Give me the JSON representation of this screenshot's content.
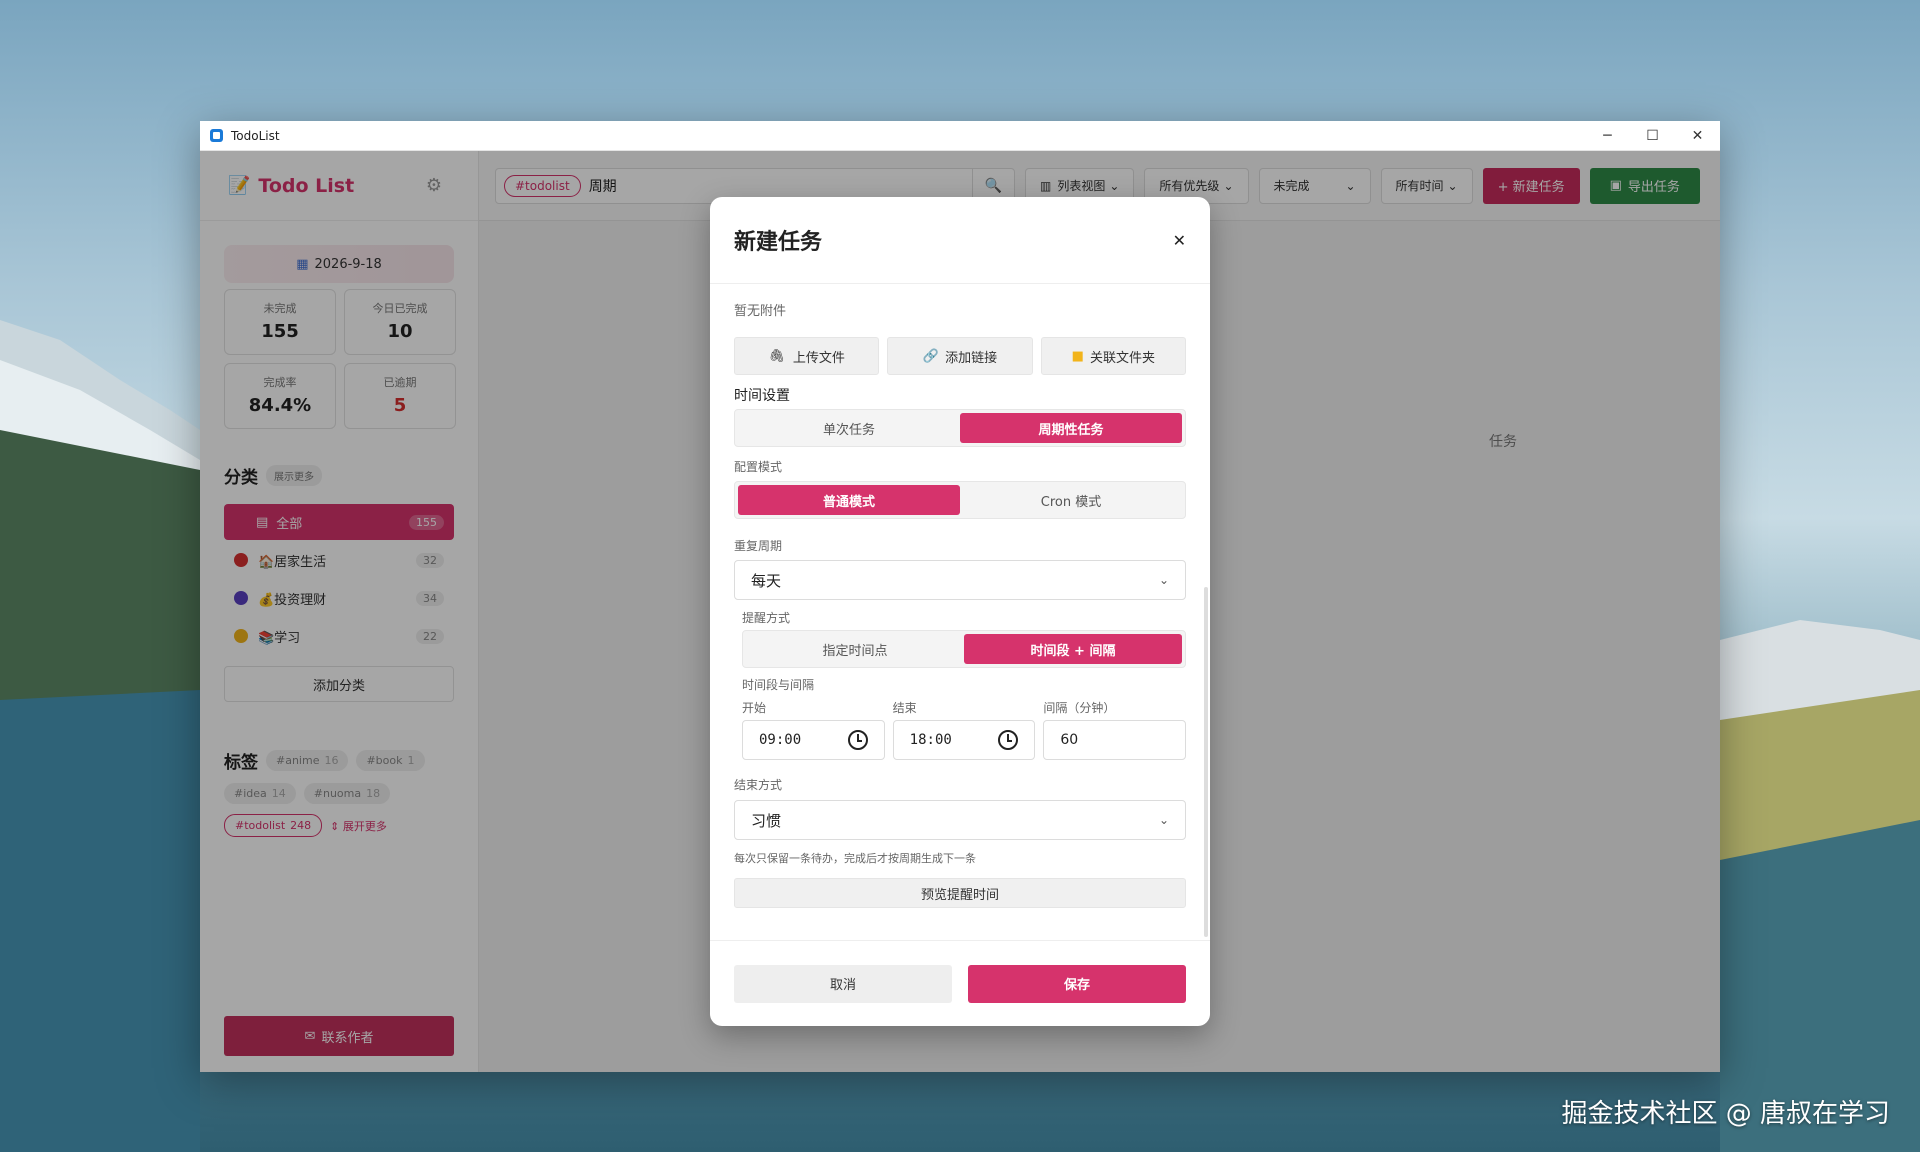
{
  "window": {
    "title": "TodoList",
    "minimize": "─",
    "maximize": "☐",
    "close": "✕"
  },
  "sidebar": {
    "logo": "Todo List",
    "date": "2026-9-18",
    "stats": [
      {
        "label": "未完成",
        "value": "155"
      },
      {
        "label": "今日已完成",
        "value": "10"
      },
      {
        "label": "完成率",
        "value": "84.4%"
      },
      {
        "label": "已逾期",
        "value": "5"
      }
    ],
    "categories_title": "分类",
    "show_more": "展示更多",
    "categories": [
      {
        "label": "全部",
        "count": "155",
        "color": "#d6336c"
      },
      {
        "label": "🏠居家生活",
        "count": "32",
        "color": "#d63030"
      },
      {
        "label": "💰投资理财",
        "count": "34",
        "color": "#5a3fc0"
      },
      {
        "label": "📚学习",
        "count": "22",
        "color": "#f2b41b"
      }
    ],
    "add_category": "添加分类",
    "tags_title": "标签",
    "tags": [
      {
        "name": "#anime",
        "count": "16"
      },
      {
        "name": "#book",
        "count": "1"
      },
      {
        "name": "#idea",
        "count": "14"
      },
      {
        "name": "#nuoma",
        "count": "18"
      },
      {
        "name": "#todolist",
        "count": "248"
      }
    ],
    "expand_more": "展开更多",
    "contact": "联系作者"
  },
  "toolbar": {
    "search_chip": "#todolist",
    "search_query": "周期",
    "view": "列表视图",
    "priority": "所有优先级",
    "status": "未完成",
    "time": "所有时间",
    "new_task": "+ 新建任务",
    "export": "导出任务"
  },
  "behind_text": "任务",
  "modal": {
    "title": "新建任务",
    "no_attachment": "暂无附件",
    "upload": "上传文件",
    "add_link": "添加链接",
    "link_folder": "关联文件夹",
    "time_settings": "时间设置",
    "task_type": {
      "single": "单次任务",
      "recurring": "周期性任务"
    },
    "config_mode_label": "配置模式",
    "config_mode": {
      "normal": "普通模式",
      "cron": "Cron 模式"
    },
    "repeat_label": "重复周期",
    "repeat_value": "每天",
    "remind_label": "提醒方式",
    "remind": {
      "point": "指定时间点",
      "range": "时间段 + 间隔"
    },
    "range_label": "时间段与间隔",
    "start_label": "开始",
    "start_value": "09:00",
    "end_label": "结束",
    "end_value": "18:00",
    "interval_label": "间隔（分钟）",
    "interval_value": "60",
    "end_mode_label": "结束方式",
    "end_mode_value": "习惯",
    "hint": "每次只保留一条待办，完成后才按周期生成下一条",
    "preview": "预览提醒时间",
    "cancel": "取消",
    "save": "保存"
  },
  "watermark": "掘金技术社区 @ 唐叔在学习"
}
